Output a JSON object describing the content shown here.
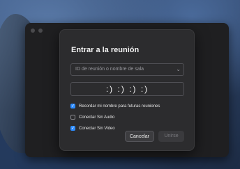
{
  "dialog": {
    "title": "Entrar a la reunión",
    "meeting_id_placeholder": "ID de reunión o nombre de sala",
    "name_value": ":) :) :) :)",
    "options": [
      {
        "label": "Recordar mi nombre para futuras reuniones",
        "checked": true
      },
      {
        "label": "Conectar Sin Audio",
        "checked": false
      },
      {
        "label": "Conectar Sin Video",
        "checked": true
      }
    ],
    "cancel_label": "Cancelar",
    "join_label": "Unirse"
  },
  "colors": {
    "accent": "#2d8cff",
    "dialog_bg": "#2c2c2e",
    "window_bg": "#1f1f21"
  }
}
